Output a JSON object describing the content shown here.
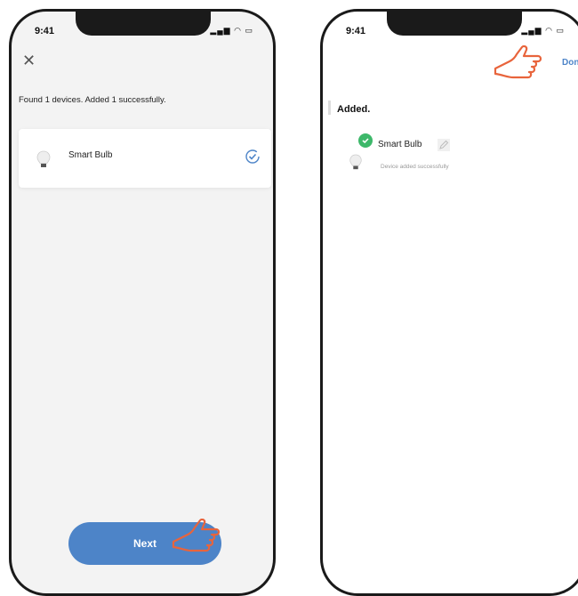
{
  "left_screen": {
    "time": "9:41",
    "found_message": "Found 1 devices. Added 1 successfully.",
    "device": {
      "name": "Smart Bulb"
    },
    "next_label": "Next"
  },
  "right_screen": {
    "time": "9:41",
    "done_label": "Done",
    "section_title": "Added.",
    "device": {
      "name": "Smart Bulb",
      "status": "Device added successfully"
    }
  },
  "colors": {
    "accent": "#4d84c8",
    "success": "#3db86a",
    "hand_outline": "#e8643c"
  },
  "icons": [
    "close-icon",
    "bulb-icon",
    "check-circle-icon",
    "hand-pointer-icon",
    "edit-icon",
    "success-check-icon",
    "signal-icon",
    "wifi-icon",
    "battery-icon"
  ]
}
